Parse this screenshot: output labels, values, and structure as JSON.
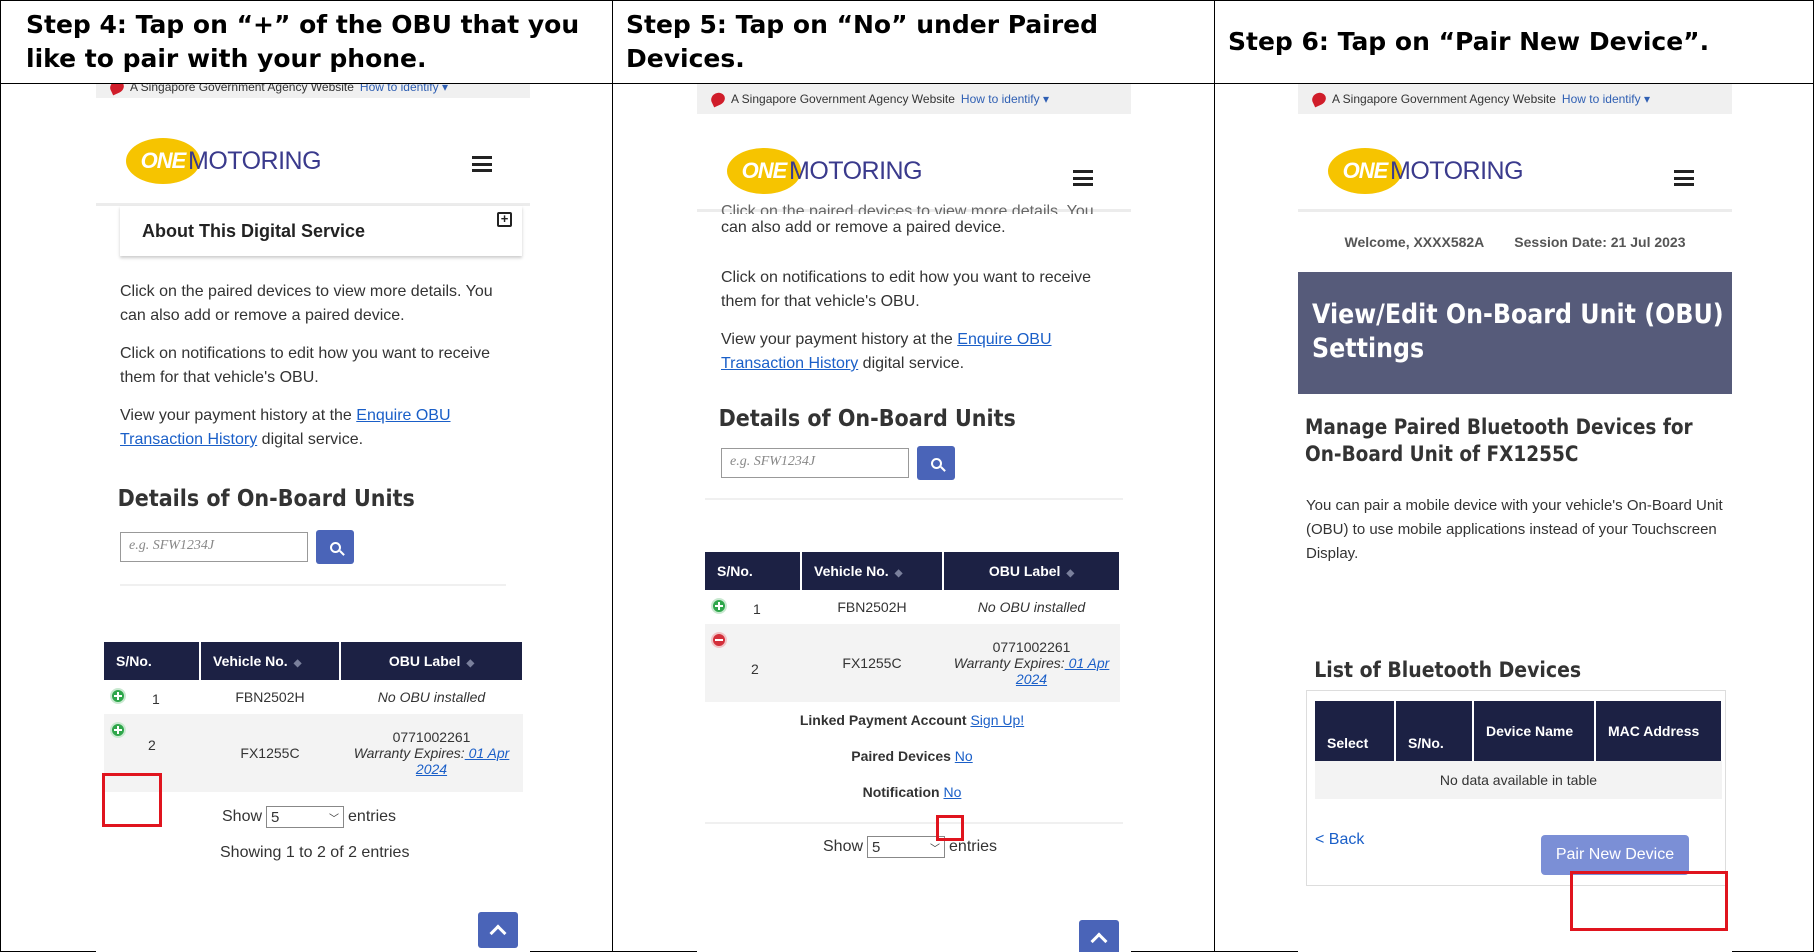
{
  "headers": {
    "step4": "Step 4: Tap on “+” of the OBU that you like to pair with your phone.",
    "step5": "Step 5: Tap on “No” under Paired Devices.",
    "step6": "Step 6: Tap on “Pair New Device”."
  },
  "gov_banner": {
    "text": "A Singapore Government Agency Website",
    "link": "How to identify"
  },
  "logo": {
    "one": "ONE",
    "motoring": "MOTORING"
  },
  "panel4": {
    "accordion_title": "About This Digital Service",
    "para1": "Click on the paired devices to view more details. You can also add or remove a paired device.",
    "para2": "Click on notifications to edit how you want to receive them for that vehicle's OBU.",
    "para3_pre": "View your payment history at the ",
    "para3_link": "Enquire OBU Transaction History",
    "para3_post": " digital service.",
    "section_title": "Details of On-Board Units",
    "search_placeholder": "e.g. SFW1234J",
    "columns": [
      "S/No.",
      "Vehicle No.",
      "OBU Label"
    ],
    "rows": [
      {
        "sno": "1",
        "vehicle": "FBN2502H",
        "label": "No OBU installed"
      },
      {
        "sno": "2",
        "vehicle": "FX1255C",
        "label_id": "0771002261",
        "warranty": "Warranty Expires:",
        "warranty_date": " 01 Apr 2024"
      }
    ],
    "show": "Show",
    "show_value": "5",
    "entries": "entries",
    "showing": "Showing 1 to 2 of 2 entries"
  },
  "panel5": {
    "para_top1": "Click on the paired devices to view more details. You",
    "para_top2": "can also add or remove a paired device.",
    "para2": "Click on notifications to edit how you want to receive them for that vehicle's OBU.",
    "para3_pre": "View your payment history at the ",
    "para3_link": "Enquire OBU Transaction History",
    "para3_post": " digital service.",
    "section_title": "Details of On-Board Units",
    "search_placeholder": "e.g. SFW1234J",
    "columns": [
      "S/No.",
      "Vehicle No.",
      "OBU Label"
    ],
    "rows": [
      {
        "sno": "1",
        "vehicle": "FBN2502H",
        "label": "No OBU installed"
      },
      {
        "sno": "2",
        "vehicle": "FX1255C",
        "label_id": "0771002261",
        "warranty": "Warranty Expires:",
        "warranty_date": " 01 Apr 2024"
      }
    ],
    "linked_label": "Linked Payment Account ",
    "linked_link": "Sign Up!",
    "paired_label": "Paired Devices ",
    "paired_link": "No",
    "notif_label": "Notification ",
    "notif_link": "No",
    "show": "Show",
    "show_value": "5",
    "entries": "entries"
  },
  "panel6": {
    "welcome": "Welcome, XXXX582A",
    "session": "Session Date:  21 Jul 2023",
    "banner_title": "View/Edit On-Board Unit (OBU) Settings",
    "manage_title": "Manage Paired Bluetooth Devices for On-Board Unit of FX1255C",
    "desc": "You can pair a mobile device with your vehicle's On-Board Unit (OBU) to use mobile applications instead of your Touchscreen Display.",
    "list_title": "List of Bluetooth Devices",
    "columns": [
      "Select",
      "S/No.",
      "Device Name",
      "MAC Address"
    ],
    "empty": "No data available in table",
    "back": "< Back",
    "pair_button": "Pair New Device"
  },
  "colors": {
    "table_header": "#1c2144",
    "banner": "#565b7a",
    "button": "#4a64b8",
    "pair_button": "#7b8fd6",
    "highlight": "#e0141e"
  }
}
